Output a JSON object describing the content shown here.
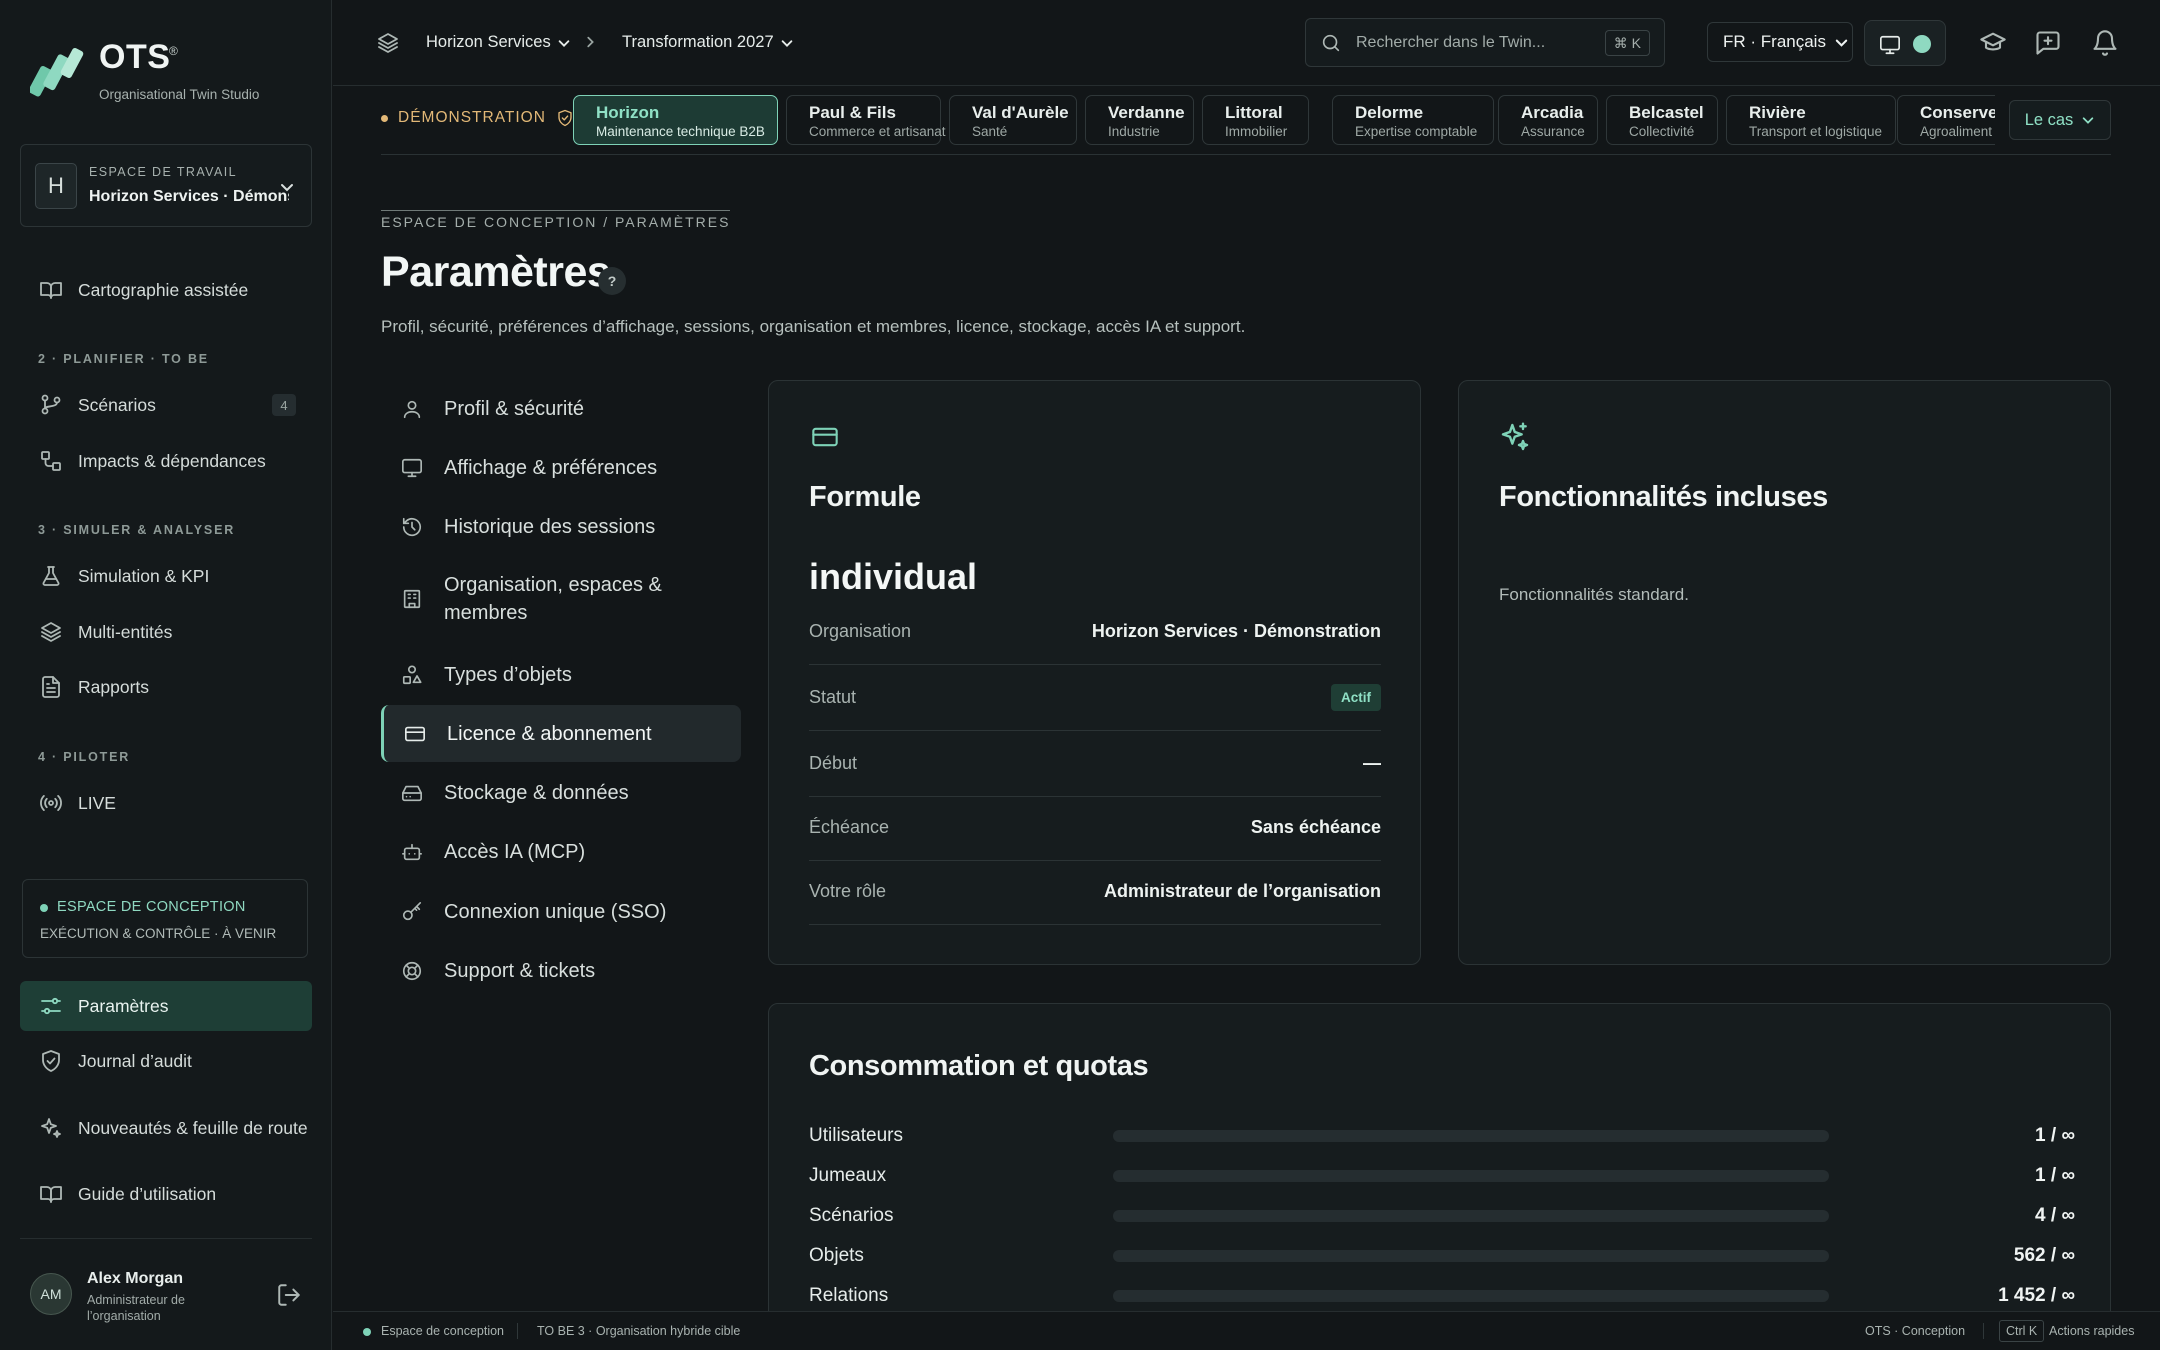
{
  "app": {
    "logo_name": "OTS",
    "logo_reg": "®",
    "logo_subtitle": "Organisational Twin Studio"
  },
  "colors": {
    "accent": "#7ed2b7",
    "demo": "#e2b877",
    "background": "#121618"
  },
  "workspace": {
    "label": "ESPACE DE TRAVAIL",
    "avatar_letter": "H",
    "name": "Horizon Services · Démonst..."
  },
  "sidebar": {
    "top_item": {
      "label": "Cartographie assistée",
      "icon": "book-open-icon"
    },
    "sections": [
      {
        "title": "2 · PLANIFIER · TO BE",
        "items": [
          {
            "label": "Scénarios",
            "icon": "git-branch-icon",
            "badge": "4"
          },
          {
            "label": "Impacts & dépendances",
            "icon": "dependencies-icon"
          }
        ]
      },
      {
        "title": "3 · SIMULER & ANALYSER",
        "items": [
          {
            "label": "Simulation & KPI",
            "icon": "flask-icon"
          },
          {
            "label": "Multi-entités",
            "icon": "layers-icon"
          },
          {
            "label": "Rapports",
            "icon": "file-text-icon"
          }
        ]
      },
      {
        "title": "4 · PILOTER",
        "items": [
          {
            "label": "LIVE",
            "icon": "broadcast-icon"
          }
        ]
      }
    ],
    "concept_box": {
      "title": "ESPACE DE CONCEPTION",
      "subtitle": "EXÉCUTION & CONTRÔLE · À VENIR"
    },
    "bottom_items": [
      {
        "label": "Paramètres",
        "icon": "sliders-icon",
        "active": true
      },
      {
        "label": "Journal d’audit",
        "icon": "shield-check-icon"
      },
      {
        "label": "Nouveautés & feuille de route",
        "icon": "sparkles-icon"
      },
      {
        "label": "Guide d’utilisation",
        "icon": "book-open-icon"
      }
    ],
    "user": {
      "initials": "AM",
      "name": "Alex Morgan",
      "role": "Administrateur de l’organisation"
    }
  },
  "topbar": {
    "crumb1": "Horizon Services",
    "crumb2": "Transformation 2027",
    "search_placeholder": "Rechercher dans le Twin...",
    "search_shortcut": "⌘ K",
    "language": "FR · Français"
  },
  "demo": {
    "label": "DÉMONSTRATION",
    "cases": [
      {
        "title": "Horizon",
        "subtitle": "Maintenance technique B2B",
        "active": true
      },
      {
        "title": "Paul & Fils",
        "subtitle": "Commerce et artisanat"
      },
      {
        "title": "Val d'Aurèle",
        "subtitle": "Santé"
      },
      {
        "title": "Verdanne",
        "subtitle": "Industrie"
      },
      {
        "title": "Littoral",
        "subtitle": "Immobilier"
      },
      {
        "title": "Delorme",
        "subtitle": "Expertise comptable"
      },
      {
        "title": "Arcadia",
        "subtitle": "Assurance"
      },
      {
        "title": "Belcastel",
        "subtitle": "Collectivité"
      },
      {
        "title": "Rivière",
        "subtitle": "Transport et logistique"
      },
      {
        "title": "Conserver",
        "subtitle": "Agroaliment"
      }
    ],
    "case_button": "Le cas"
  },
  "page": {
    "breadcrumb": "ESPACE DE CONCEPTION / PARAMÈTRES",
    "title": "Paramètres",
    "help": "?",
    "subtitle": "Profil, sécurité, préférences d’affichage, sessions, organisation et membres, licence, stockage, accès IA et support."
  },
  "settings_menu": [
    {
      "label": "Profil & sécurité",
      "icon": "user-icon"
    },
    {
      "label": "Affichage & préférences",
      "icon": "monitor-icon"
    },
    {
      "label": "Historique des sessions",
      "icon": "history-icon"
    },
    {
      "label": "Organisation, espaces & membres",
      "icon": "building-icon"
    },
    {
      "label": "Types d’objets",
      "icon": "shapes-icon"
    },
    {
      "label": "Licence & abonnement",
      "icon": "credit-card-icon",
      "active": true
    },
    {
      "label": "Stockage & données",
      "icon": "hard-drive-icon"
    },
    {
      "label": "Accès IA (MCP)",
      "icon": "bot-icon"
    },
    {
      "label": "Connexion unique (SSO)",
      "icon": "key-icon"
    },
    {
      "label": "Support & tickets",
      "icon": "life-buoy-icon"
    }
  ],
  "formule": {
    "title": "Formule",
    "plan": "individual",
    "rows": [
      {
        "key": "Organisation",
        "value": "Horizon Services · Démonstration"
      },
      {
        "key": "Statut",
        "value": "Actif",
        "badge": true
      },
      {
        "key": "Début",
        "value": "—"
      },
      {
        "key": "Échéance",
        "value": "Sans échéance"
      },
      {
        "key": "Votre rôle",
        "value": "Administrateur de l’organisation"
      }
    ]
  },
  "features": {
    "title": "Fonctionnalités incluses",
    "text": "Fonctionnalités standard."
  },
  "quotas": {
    "title": "Consommation et quotas",
    "rows": [
      {
        "key": "Utilisateurs",
        "value": "1 / ∞",
        "fill": 0
      },
      {
        "key": "Jumeaux",
        "value": "1 / ∞",
        "fill": 0
      },
      {
        "key": "Scénarios",
        "value": "4 / ∞",
        "fill": 0
      },
      {
        "key": "Objets",
        "value": "562 / ∞",
        "fill": 0
      },
      {
        "key": "Relations",
        "value": "1 452 / ∞",
        "fill": 0
      }
    ]
  },
  "statusbar": {
    "mode": "Espace de conception",
    "context": "TO BE 3 · Organisation hybride cible",
    "app_mode": "OTS · Conception",
    "shortcut": "Ctrl K",
    "shortcut_label": "Actions rapides"
  }
}
